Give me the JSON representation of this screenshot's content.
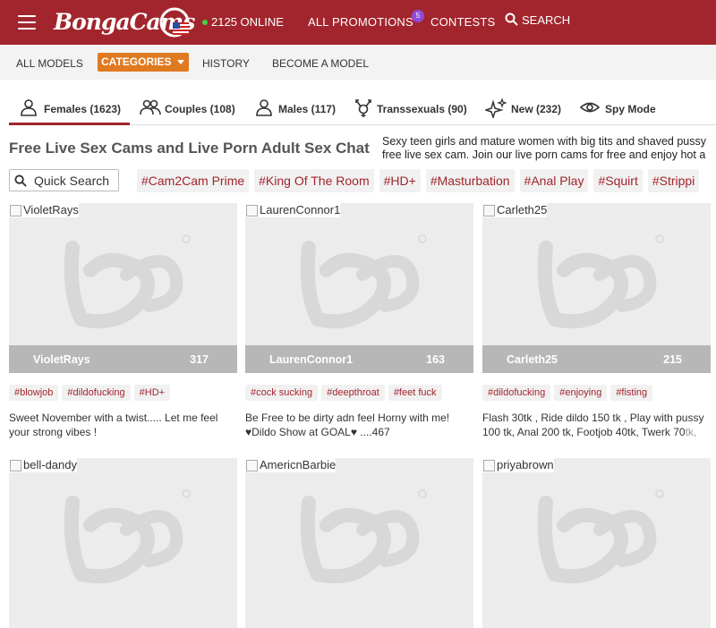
{
  "header": {
    "logo_text": "BongaCams",
    "online_count": "2125 ONLINE",
    "nav": [
      "ALL PROMOTIONS",
      "CONTESTS"
    ],
    "promo_badge": "5",
    "search_label": "SEARCH"
  },
  "subnav": {
    "items": [
      "ALL MODELS",
      "CATEGORIES",
      "HISTORY",
      "BECOME A MODEL"
    ]
  },
  "gender_tabs": [
    {
      "label": "Females (1623)",
      "icon": "female-icon"
    },
    {
      "label": "Couples (108)",
      "icon": "couples-icon"
    },
    {
      "label": "Males (117)",
      "icon": "male-icon"
    },
    {
      "label": "Transsexuals (90)",
      "icon": "transsexual-icon"
    },
    {
      "label": "New (232)",
      "icon": "sparkle-icon"
    },
    {
      "label": "Spy Mode",
      "icon": "eye-icon"
    }
  ],
  "heading": "Free Live Sex Cams and Live Porn Adult Sex Chat",
  "description": {
    "line1": "Sexy teen girls and mature women with big tits and shaved pussy",
    "line2": "free live sex cam. Join our live porn cams for free and enjoy hot a"
  },
  "quick_search": {
    "placeholder": "Quick Search"
  },
  "tags": [
    "#Cam2Cam Prime",
    "#King Of The Room",
    "#HD+",
    "#Masturbation",
    "#Anal Play",
    "#Squirt",
    "#Strippi"
  ],
  "cards": [
    {
      "name": "VioletRays",
      "count": "317",
      "tags": [
        "#blowjob",
        "#dildofucking",
        "#HD+"
      ],
      "text": "Sweet November with a twist..... Let me feel your strong vibes !"
    },
    {
      "name": "LaurenConnor1",
      "count": "163",
      "tags": [
        "#cock sucking",
        "#deepthroat",
        "#feet fuck"
      ],
      "text": "Be Free to be dirty adn feel Horny with me! ♥Dildo Show at GOAL♥ ....467"
    },
    {
      "name": "Carleth25",
      "count": "215",
      "tags": [
        "#dildofucking",
        "#enjoying",
        "#fisting"
      ],
      "text": "Flash 30tk , Ride dildo 150 tk , Play with pussy 100 tk, Anal 200 tk, Footjob 40tk, Twerk 70",
      "text_fade": "tk,"
    },
    {
      "name": "bell-dandy"
    },
    {
      "name": "AmericnBarbie"
    },
    {
      "name": "priyabrown"
    }
  ],
  "colors": {
    "brand": "#a2252d",
    "accent": "#e07a20",
    "badge": "#8e4bd8",
    "online": "#3fd33f"
  }
}
